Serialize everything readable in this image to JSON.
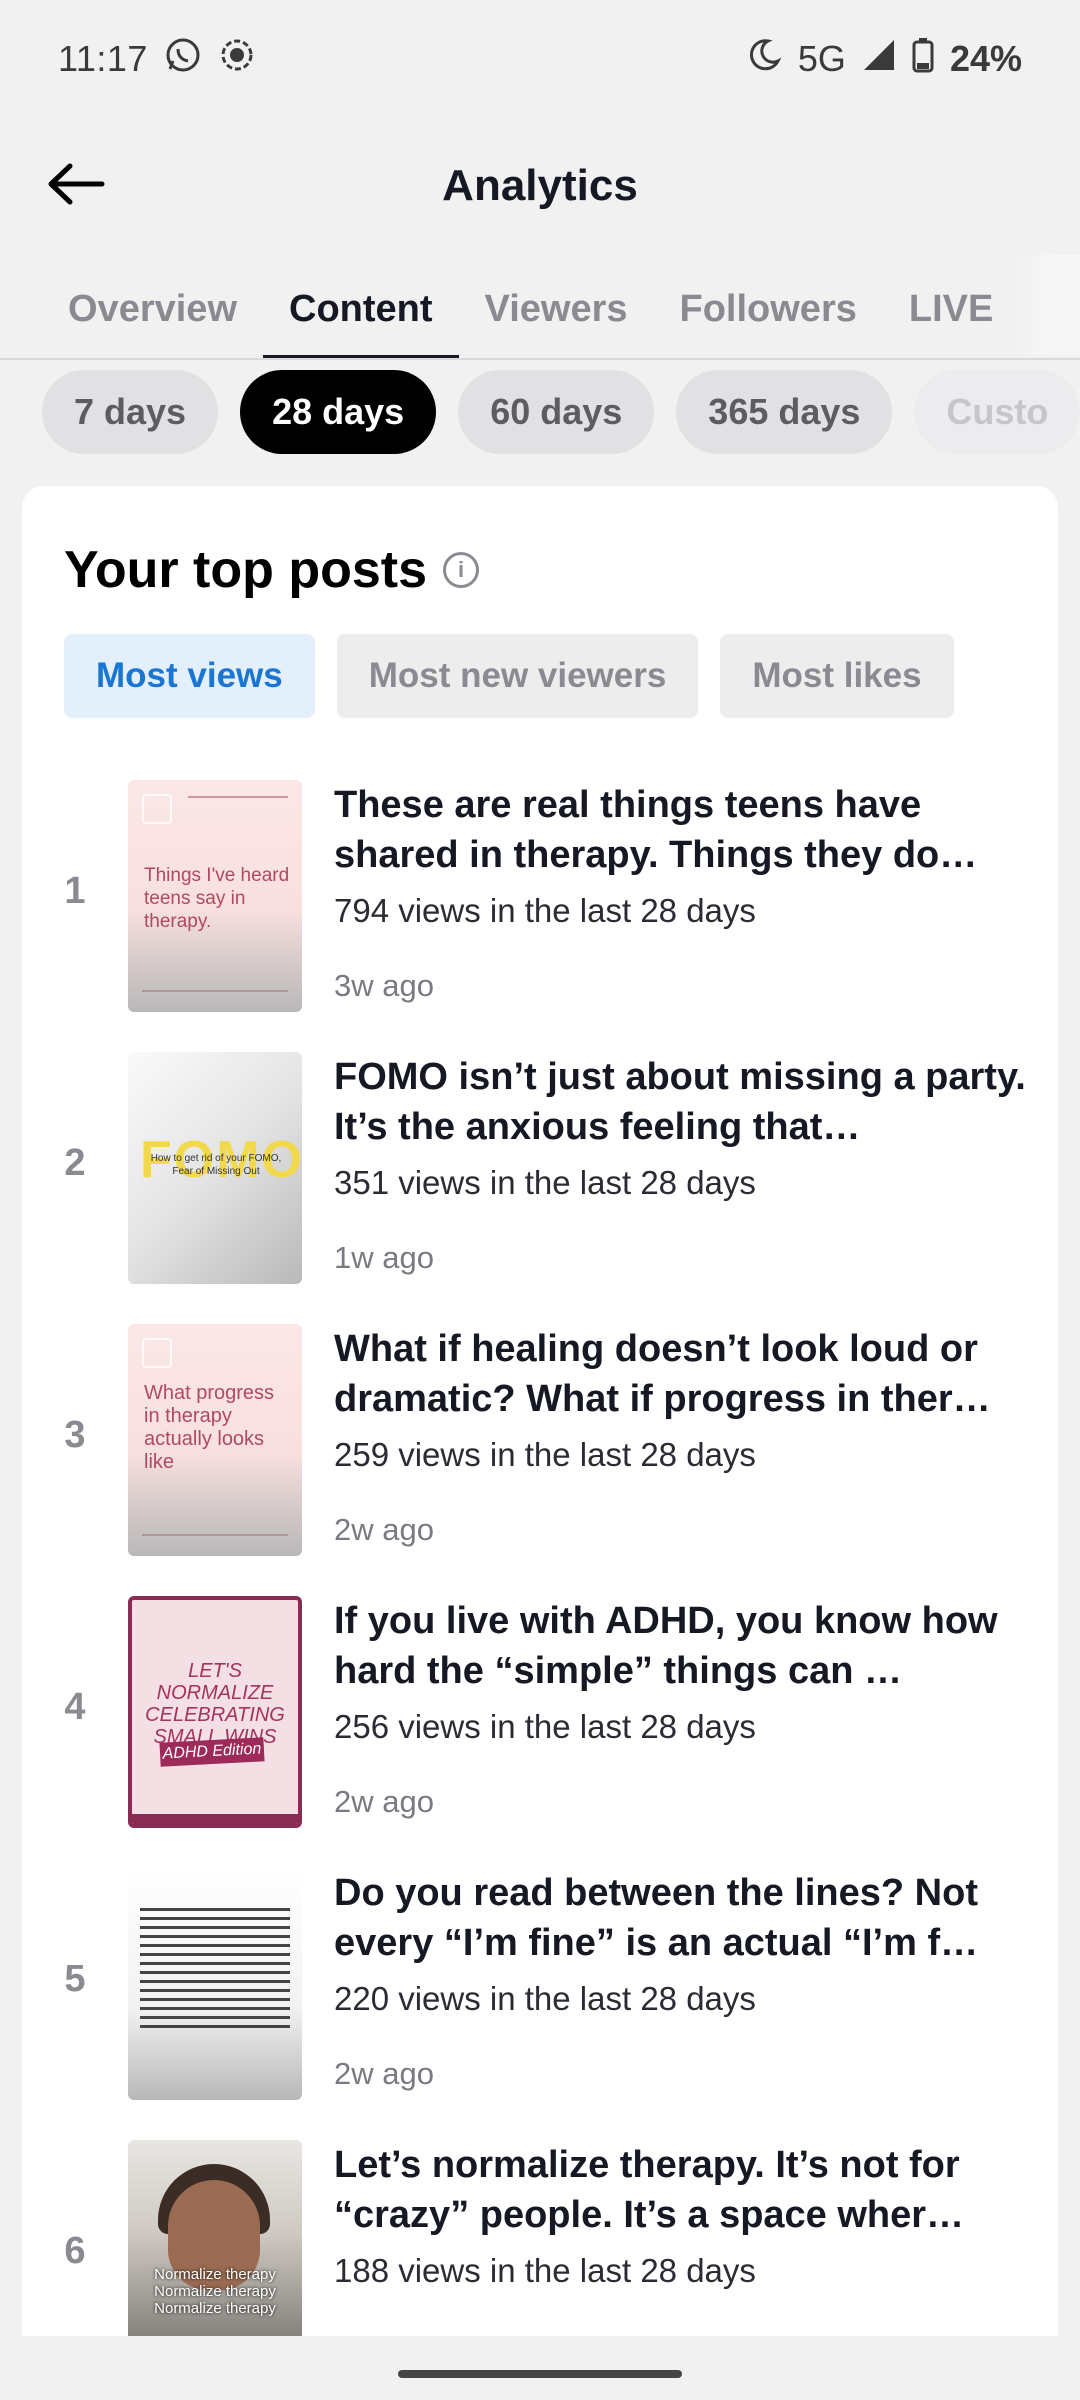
{
  "status_bar": {
    "time": "11:17",
    "network": "5G",
    "battery": "24%"
  },
  "header": {
    "title": "Analytics"
  },
  "tabs": [
    {
      "label": "Overview"
    },
    {
      "label": "Content"
    },
    {
      "label": "Viewers"
    },
    {
      "label": "Followers"
    },
    {
      "label": "LIVE"
    }
  ],
  "active_tab": "Content",
  "date_ranges": [
    {
      "label": "7 days"
    },
    {
      "label": "28 days"
    },
    {
      "label": "60 days"
    },
    {
      "label": "365 days"
    },
    {
      "label": "Custo"
    }
  ],
  "active_range": "28 days",
  "top_posts": {
    "title": "Your top posts",
    "filters": [
      {
        "label": "Most views"
      },
      {
        "label": "Most new viewers"
      },
      {
        "label": "Most likes"
      }
    ],
    "active_filter": "Most views",
    "items": [
      {
        "rank": "1",
        "title": "These are real things teens have shared in therapy. Things they do…",
        "views": "794 views in the last 28 days",
        "age": "3w ago",
        "thumb_text": "Things I've heard teens say in therapy."
      },
      {
        "rank": "2",
        "title": "FOMO isn’t just about missing a party. It’s the anxious feeling that…",
        "views": "351 views in the last 28 days",
        "age": "1w ago",
        "thumb_text": "FOMO",
        "thumb_subtext": "How to get rid of your FOMO, Fear of Missing Out"
      },
      {
        "rank": "3",
        "title": "What if healing doesn’t look loud or dramatic? What if progress in ther…",
        "views": "259 views in the last 28 days",
        "age": "2w ago",
        "thumb_text": "What progress in therapy actually looks like"
      },
      {
        "rank": "4",
        "title": "If you live with ADHD, you know how hard the “simple” things can …",
        "views": "256 views in the last 28 days",
        "age": "2w ago",
        "thumb_text": "LET'S NORMALIZE CELEBRATING SMALL WINS",
        "thumb_subtext": "ADHD Edition"
      },
      {
        "rank": "5",
        "title": "Do you read between the lines? Not every “I’m fine” is an actual “I’m f…",
        "views": "220 views in the last 28 days",
        "age": "2w ago"
      },
      {
        "rank": "6",
        "title": "Let’s normalize therapy. It’s not for “crazy” people. It’s a space wher…",
        "views": "188 views in the last 28 days",
        "age": "",
        "thumb_text": "Normalize therapy Normalize therapy Normalize therapy"
      }
    ]
  }
}
